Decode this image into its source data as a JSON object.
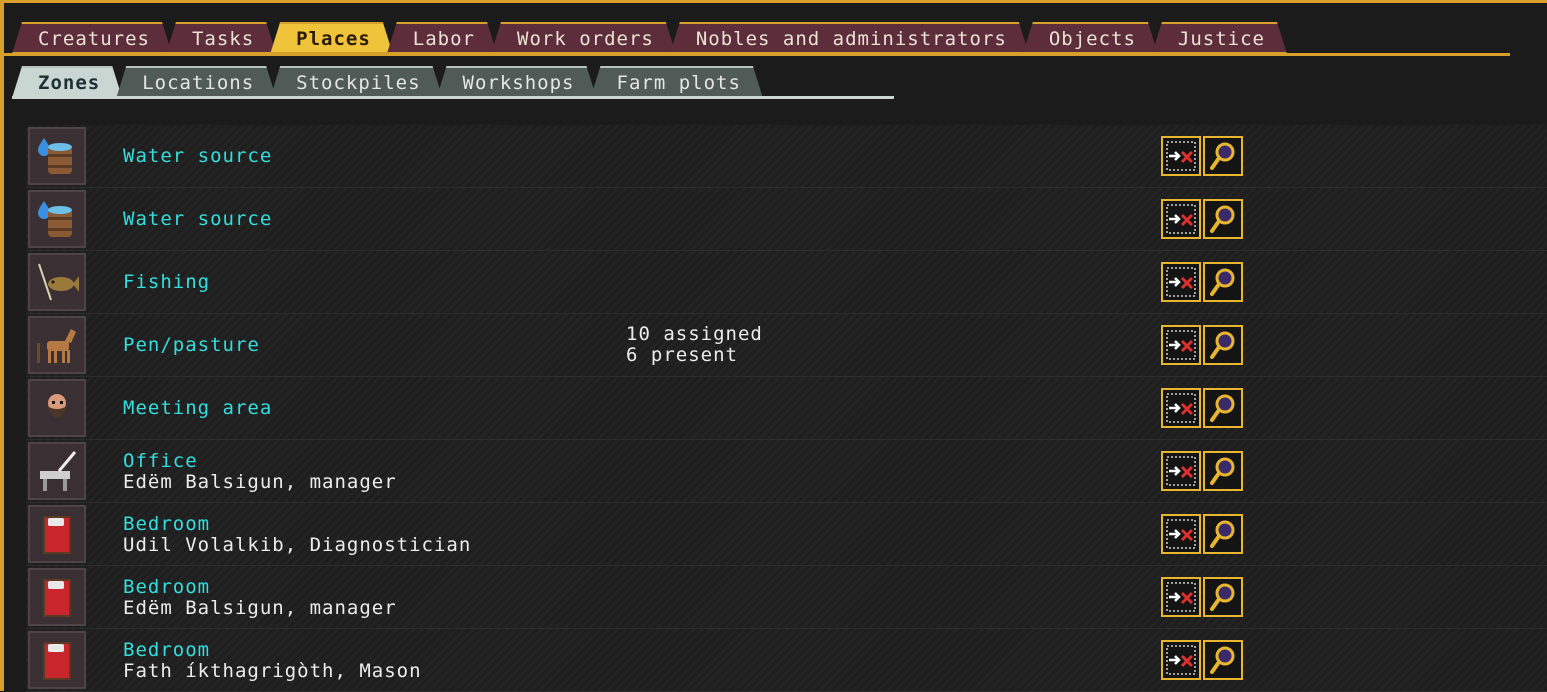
{
  "main_tabs": [
    {
      "label": "Creatures",
      "active": false
    },
    {
      "label": "Tasks",
      "active": false
    },
    {
      "label": "Places",
      "active": true
    },
    {
      "label": "Labor",
      "active": false
    },
    {
      "label": "Work orders",
      "active": false
    },
    {
      "label": "Nobles and administrators",
      "active": false
    },
    {
      "label": "Objects",
      "active": false
    },
    {
      "label": "Justice",
      "active": false
    }
  ],
  "sub_tabs": [
    {
      "label": "Zones",
      "active": true
    },
    {
      "label": "Locations",
      "active": false
    },
    {
      "label": "Stockpiles",
      "active": false
    },
    {
      "label": "Workshops",
      "active": false
    },
    {
      "label": "Farm plots",
      "active": false
    }
  ],
  "zones": [
    {
      "icon": "water-barrel-icon",
      "name": "Water source",
      "sub": "",
      "info": []
    },
    {
      "icon": "water-barrel-icon",
      "name": "Water source",
      "sub": "",
      "info": []
    },
    {
      "icon": "fishing-icon",
      "name": "Fishing",
      "sub": "",
      "info": []
    },
    {
      "icon": "horse-icon",
      "name": "Pen/pasture",
      "sub": "",
      "info": [
        "10 assigned",
        "6 present"
      ]
    },
    {
      "icon": "dwarf-face-icon",
      "name": "Meeting area",
      "sub": "",
      "info": []
    },
    {
      "icon": "quill-desk-icon",
      "name": "Office",
      "sub": "Edëm Balsigun, manager",
      "info": []
    },
    {
      "icon": "bed-icon",
      "name": "Bedroom",
      "sub": "Udil Volalkib, Diagnostician",
      "info": []
    },
    {
      "icon": "bed-icon",
      "name": "Bedroom",
      "sub": "Edëm Balsigun, manager",
      "info": []
    },
    {
      "icon": "bed-icon",
      "name": "Bedroom",
      "sub": "Fath íkthagrigòth, Mason",
      "info": []
    }
  ],
  "row_buttons": {
    "remove_icon": "remove-zone-icon",
    "zoom_icon": "magnifier-icon"
  },
  "colors": {
    "accent": "#d7a02a",
    "active_tab": "#f0c43a",
    "zone_name": "#33dede",
    "text": "#ececec"
  }
}
